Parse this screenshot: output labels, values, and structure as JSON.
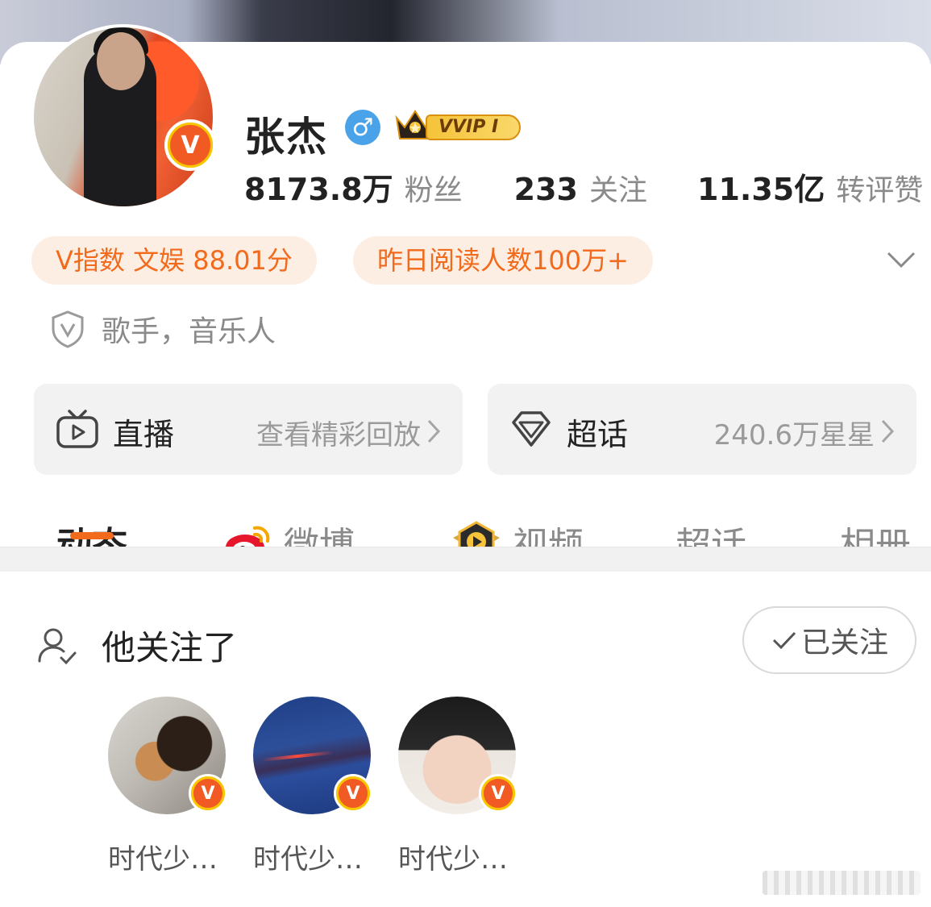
{
  "profile": {
    "name": "张杰",
    "gender_symbol": "♂",
    "vip_label": "VVIP I",
    "verified_badge": "V"
  },
  "stats": [
    {
      "value": "8173.8万",
      "label": "粉丝"
    },
    {
      "value": "233",
      "label": "关注"
    },
    {
      "value": "11.35亿",
      "label": "转评赞"
    }
  ],
  "tags": {
    "v_index": "V指数 文娱 88.01分",
    "reads": "昨日阅读人数100万+"
  },
  "identity": "歌手，音乐人",
  "cards": {
    "live": {
      "title": "直播",
      "subtitle": "查看精彩回放"
    },
    "topic": {
      "title": "超话",
      "subtitle": "240.6万星星"
    }
  },
  "tabs": [
    "动态",
    "微博",
    "视频",
    "超话",
    "相册"
  ],
  "following": {
    "title": "他关注了",
    "button": "已关注",
    "accounts": [
      {
        "name": "时代少…"
      },
      {
        "name": "时代少…"
      },
      {
        "name": "时代少…"
      }
    ]
  },
  "colors": {
    "accent": "#f26a1b",
    "tag_bg": "#fdeee4",
    "card_bg": "#f2f2f2",
    "badge_orange": "#f15a22",
    "badge_gold": "#f7b500",
    "gender_blue": "#4aa3e8"
  },
  "icons": [
    "tv-icon",
    "diamond-icon",
    "weibo-logo-icon",
    "video-play-icon",
    "user-check-icon",
    "shield-v-icon",
    "chevron-down-icon",
    "chevron-right-icon",
    "check-icon",
    "crown-icon"
  ]
}
